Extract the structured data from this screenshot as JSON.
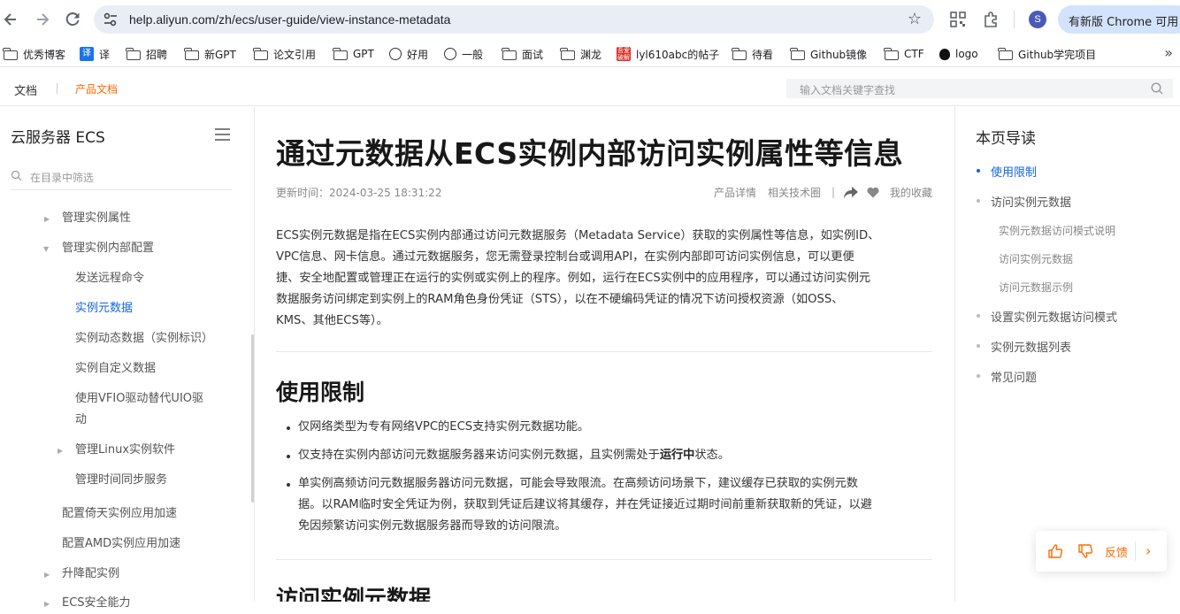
{
  "browser": {
    "url": "help.aliyun.com/zh/ecs/user-guide/view-instance-metadata",
    "profile_initial": "S",
    "update_button": "有新版 Chrome 可用",
    "icons": [
      "back-icon",
      "forward-icon",
      "reload-icon",
      "site-settings-icon",
      "bookmark-star-icon",
      "qr-code-icon",
      "extensions-icon"
    ]
  },
  "bookmarks": [
    {
      "label": "优秀博客",
      "icon": "folder"
    },
    {
      "label": "译",
      "icon": "translate"
    },
    {
      "label": "招聘",
      "icon": "folder"
    },
    {
      "label": "新GPT",
      "icon": "folder"
    },
    {
      "label": "论文引用",
      "icon": "folder"
    },
    {
      "label": "GPT",
      "icon": "folder"
    },
    {
      "label": "好用",
      "icon": "openai"
    },
    {
      "label": "一般",
      "icon": "openai"
    },
    {
      "label": "面试",
      "icon": "folder"
    },
    {
      "label": "渊龙",
      "icon": "folder"
    },
    {
      "label": "lyl610abc的帖子",
      "icon": "site"
    },
    {
      "label": "待看",
      "icon": "folder"
    },
    {
      "label": "Github镜像",
      "icon": "folder"
    },
    {
      "label": "CTF",
      "icon": "folder"
    },
    {
      "label": "logo",
      "icon": "apple"
    },
    {
      "label": "Github学完项目",
      "icon": "folder"
    }
  ],
  "site_header": {
    "docs": "文档",
    "product_docs": "产品文档",
    "search_placeholder": "输入文档关键字查找"
  },
  "sidebar": {
    "title": "云服务器 ECS",
    "filter_placeholder": "在目录中筛选",
    "items": [
      {
        "label": "管理实例属性",
        "level": 1,
        "arrow": "right"
      },
      {
        "label": "管理实例内部配置",
        "level": 1,
        "arrow": "down"
      },
      {
        "label": "发送远程命令",
        "level": 2
      },
      {
        "label": "实例元数据",
        "level": 2,
        "active": true
      },
      {
        "label": "实例动态数据（实例标识）",
        "level": 2
      },
      {
        "label": "实例自定义数据",
        "level": 2
      },
      {
        "label": "使用VFIO驱动替代UIO驱",
        "level": 2
      },
      {
        "label": "动",
        "level": 2
      },
      {
        "label": "管理Linux实例软件",
        "level": 2,
        "arrow": "right"
      },
      {
        "label": "管理时间同步服务",
        "level": 2
      },
      {
        "label": "配置倚天实例应用加速",
        "level": 1
      },
      {
        "label": "配置AMD实例应用加速",
        "level": 1
      },
      {
        "label": "升降配实例",
        "level": 1,
        "arrow": "right"
      },
      {
        "label": "ECS安全能力",
        "level": 1,
        "arrow": "right"
      }
    ]
  },
  "main": {
    "title": "通过元数据从ECS实例内部访问实例属性等信息",
    "updated": "更新时间：2024-03-25 18:31:22",
    "product_details": "产品详情",
    "related_tech": "相关技术圈",
    "divider": "|",
    "my_favorites": "我的收藏",
    "intro_lines": [
      "ECS实例元数据是指在ECS实例内部通过访问元数据服务（Metadata Service）获取的实例属性等信息，如实例ID、",
      "VPC信息、网卡信息。通过元数据服务，您无需登录控制台或调用API，在实例内部即可访问实例信息，可以更便",
      "捷、安全地配置或管理正在运行的实例或实例上的程序。例如，运行在ECS实例中的应用程序，可以通过访问实例元",
      "数据服务访问绑定到实例上的RAM角色身份凭证（STS），以在不硬编码凭证的情况下访问授权资源（如OSS、",
      "KMS、其他ECS等）。"
    ],
    "section1_title": "使用限制",
    "bullets": {
      "b1": "仅网络类型为专有网络VPC的ECS支持实例元数据功能。",
      "b2_pre": "仅支持在实例内部访问元数据服务器来访问实例元数据，且实例需处于",
      "b2_bold": "运行中",
      "b2_post": "状态。",
      "b3_lines": [
        "单实例高频访问元数据服务器访问元数据，可能会导致限流。在高频访问场景下，建议缓存已获取的实例元数",
        "据。以RAM临时安全凭证为例，获取到凭证后建议将其缓存，并在凭证接近过期时间前重新获取新的凭证，以避",
        "免因频繁访问实例元数据服务器而导致的访问限流。"
      ]
    },
    "section2_title": "访问实例元数据"
  },
  "rightnav": {
    "title": "本页导读",
    "items": [
      {
        "label": "使用限制",
        "level": 1,
        "active": true
      },
      {
        "label": "访问实例元数据",
        "level": 1
      },
      {
        "label": "实例元数据访问模式说明",
        "level": 2
      },
      {
        "label": "访问实例元数据",
        "level": 2
      },
      {
        "label": "访问元数据示例",
        "level": 2
      },
      {
        "label": "设置实例元数据访问模式",
        "level": 1
      },
      {
        "label": "实例元数据列表",
        "level": 1
      },
      {
        "label": "常见问题",
        "level": 1
      }
    ]
  },
  "feedback": {
    "label": "反馈"
  },
  "colors": {
    "accent_orange": "#ff6a00",
    "link_blue": "#1464e4"
  }
}
